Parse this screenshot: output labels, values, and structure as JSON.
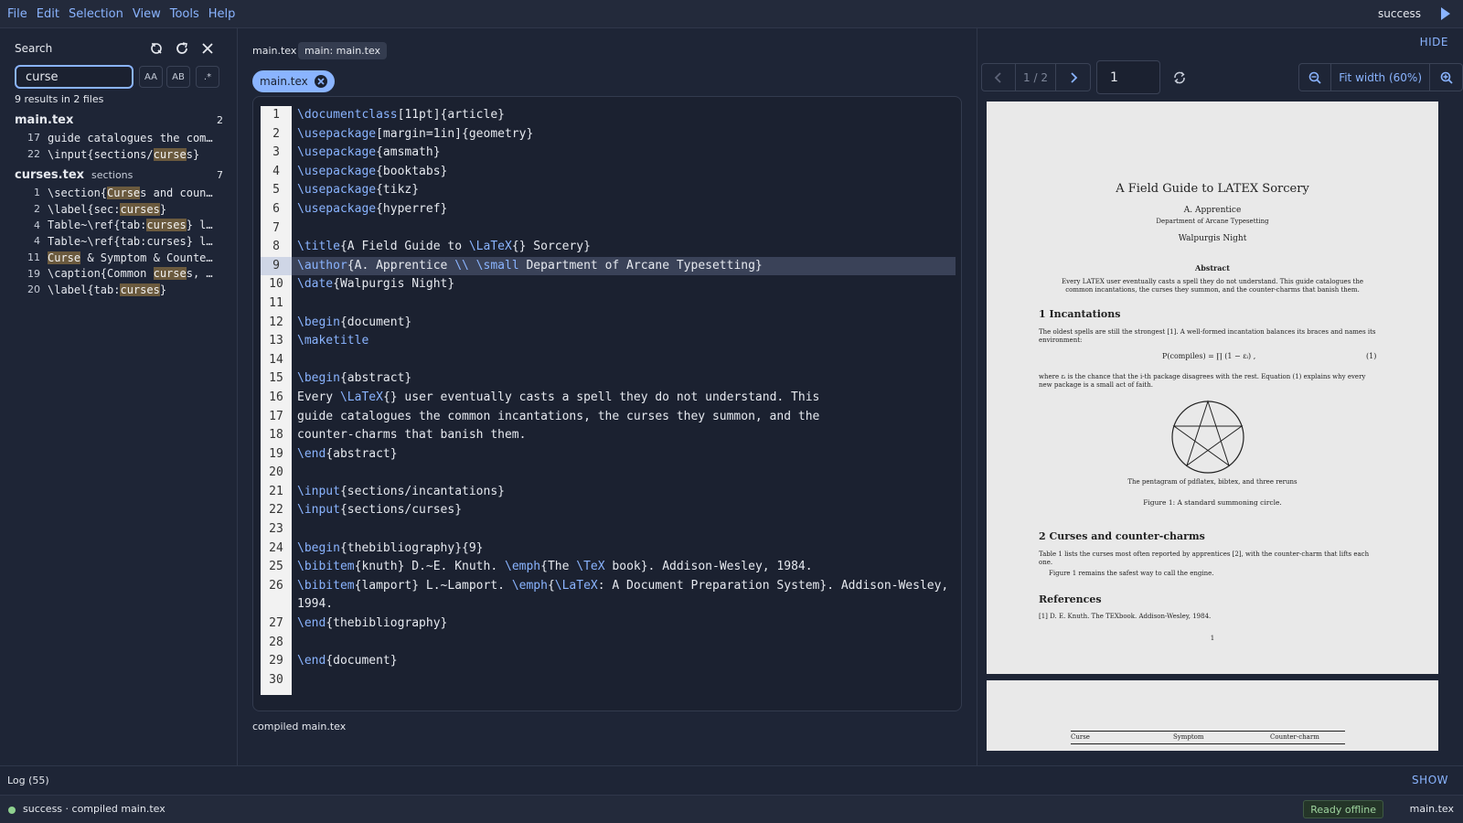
{
  "menubar": {
    "items": [
      "File",
      "Edit",
      "Selection",
      "View",
      "Tools",
      "Help"
    ],
    "run_status": "success"
  },
  "search": {
    "title": "Search",
    "query": "curse",
    "options": [
      "AA",
      "AB",
      ".*"
    ],
    "summary": "9 results in 2 files",
    "files": [
      {
        "name": "main.tex",
        "dir": "",
        "count": "2",
        "matches": [
          {
            "line": "17",
            "pre": "guide catalogues the com…",
            "hit": "",
            "post": ""
          },
          {
            "line": "22",
            "pre": "\\input{sections/",
            "hit": "curse",
            "post": "s}"
          }
        ]
      },
      {
        "name": "curses.tex",
        "dir": "sections",
        "count": "7",
        "matches": [
          {
            "line": "1",
            "pre": "\\section{",
            "hit": "Curse",
            "post": "s and coun…"
          },
          {
            "line": "2",
            "pre": "\\label{sec:",
            "hit": "curses",
            "post": "}"
          },
          {
            "line": "4",
            "pre": "Table~\\ref{tab:",
            "hit": "curses",
            "post": "} l…"
          },
          {
            "line": "4",
            "pre": "Table~\\ref{tab:curses} l…",
            "hit": "",
            "post": ""
          },
          {
            "line": "11",
            "pre": "",
            "hit": "Curse",
            "post": " & Symptom & Counte…"
          },
          {
            "line": "19",
            "pre": "\\caption{Common ",
            "hit": "curse",
            "post": "s, …"
          },
          {
            "line": "20",
            "pre": "\\label{tab:",
            "hit": "curses",
            "post": "}"
          }
        ]
      }
    ]
  },
  "editor": {
    "breadcrumb_file": "main.tex",
    "breadcrumb_chip": "main: main.tex",
    "tab_label": "main.tex",
    "compiled_text": "compiled main.tex",
    "lines": [
      {
        "n": "1",
        "cmd": "\\documentclass",
        "rest": "[11pt]{article}"
      },
      {
        "n": "2",
        "cmd": "\\usepackage",
        "rest": "[margin=1in]{geometry}"
      },
      {
        "n": "3",
        "cmd": "\\usepackage",
        "rest": "{amsmath}"
      },
      {
        "n": "4",
        "cmd": "\\usepackage",
        "rest": "{booktabs}"
      },
      {
        "n": "5",
        "cmd": "\\usepackage",
        "rest": "{tikz}"
      },
      {
        "n": "6",
        "cmd": "\\usepackage",
        "rest": "{hyperref}"
      },
      {
        "n": "7",
        "cmd": "",
        "rest": ""
      },
      {
        "n": "8",
        "cmd": "\\title",
        "rest": "{A Field Guide to ",
        "cmd2": "\\LaTeX",
        "rest2": "{} Sorcery}"
      },
      {
        "n": "9",
        "cmd": "\\author",
        "rest": "{A. Apprentice ",
        "cmd2": "\\\\ \\small",
        "rest2": " Department of Arcane Typesetting}",
        "active": true
      },
      {
        "n": "10",
        "cmd": "\\date",
        "rest": "{Walpurgis Night}"
      },
      {
        "n": "11",
        "cmd": "",
        "rest": ""
      },
      {
        "n": "12",
        "cmd": "\\begin",
        "rest": "{document}"
      },
      {
        "n": "13",
        "cmd": "\\maketitle",
        "rest": ""
      },
      {
        "n": "14",
        "cmd": "",
        "rest": ""
      },
      {
        "n": "15",
        "cmd": "\\begin",
        "rest": "{abstract}"
      },
      {
        "n": "16",
        "cmd": "",
        "rest": "Every ",
        "cmd2": "\\LaTeX",
        "rest2": "{} user eventually casts a spell they do not understand. This"
      },
      {
        "n": "17",
        "cmd": "",
        "rest": "guide catalogues the common incantations, the curses they summon, and the"
      },
      {
        "n": "18",
        "cmd": "",
        "rest": "counter-charms that banish them."
      },
      {
        "n": "19",
        "cmd": "\\end",
        "rest": "{abstract}"
      },
      {
        "n": "20",
        "cmd": "",
        "rest": ""
      },
      {
        "n": "21",
        "cmd": "\\input",
        "rest": "{sections/incantations}"
      },
      {
        "n": "22",
        "cmd": "\\input",
        "rest": "{sections/curses}"
      },
      {
        "n": "23",
        "cmd": "",
        "rest": ""
      },
      {
        "n": "24",
        "cmd": "\\begin",
        "rest": "{thebibliography}{9}"
      },
      {
        "n": "25",
        "cmd": "\\bibitem",
        "rest": "{knuth} D.~E. Knuth. ",
        "cmd2": "\\emph",
        "rest2": "{The ",
        "cmd3": "\\TeX",
        "rest3": " book}. Addison-Wesley, 1984."
      },
      {
        "n": "26",
        "cmd": "\\bibitem",
        "rest": "{lamport} L.~Lamport. ",
        "cmd2": "\\emph",
        "rest2": "{",
        "cmd3": "\\LaTeX",
        "rest3": ": A Document Preparation System}. Addison-Wesley, 1994.",
        "wrap": true
      },
      {
        "n": "27",
        "cmd": "\\end",
        "rest": "{thebibliography}"
      },
      {
        "n": "28",
        "cmd": "",
        "rest": ""
      },
      {
        "n": "29",
        "cmd": "\\end",
        "rest": "{document}"
      },
      {
        "n": "30",
        "cmd": "",
        "rest": ""
      }
    ]
  },
  "preview": {
    "hide_label": "HIDE",
    "page_indicator": "1 / 2",
    "page_input": "1",
    "zoom_label": "Fit width (60%)",
    "pdf": {
      "title": "A Field Guide to LATEX Sorcery",
      "author": "A. Apprentice",
      "dept": "Department of Arcane Typesetting",
      "date": "Walpurgis Night",
      "abstract_head": "Abstract",
      "abstract_text": "Every LATEX user eventually casts a spell they do not understand. This guide catalogues the common incantations, the curses they summon, and the counter-charms that banish them.",
      "sec1": "1    Incantations",
      "sec1_p1": "The oldest spells are still the strongest [1]. A well-formed incantation balances its braces and names its environment:",
      "equation": "P(compiles) = ∏ (1 − εᵢ) ,",
      "eq_num": "(1)",
      "sec1_p2": "where εᵢ is the chance that the i-th package disagrees with the rest. Equation (1) explains why every new package is a small act of faith.",
      "fig_caption_inner": "The pentagram of pdflatex, bibtex, and three reruns",
      "fig_caption": "Figure 1: A standard summoning circle.",
      "sec2": "2    Curses and counter-charms",
      "sec2_p1": "Table 1 lists the curses most often reported by apprentices [2], with the counter-charm that lifts each one.",
      "sec2_p2": "Figure 1 remains the safest way to call the engine.",
      "refs_head": "References",
      "ref1": "[1] D. E. Knuth. The TEXbook. Addison-Wesley, 1984.",
      "page_num": "1",
      "table_headers": [
        "Curse",
        "Symptom",
        "Counter-charm"
      ]
    }
  },
  "log": {
    "label": "Log (55)",
    "show_label": "SHOW"
  },
  "statusbar": {
    "status": "success · compiled main.tex",
    "ready": "Ready offline",
    "file": "main.tex"
  }
}
